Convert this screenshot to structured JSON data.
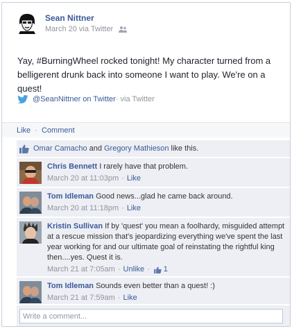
{
  "post": {
    "author": "Sean Nittner",
    "meta": "March 20 via Twitter",
    "text": "Yay, #BurningWheel rocked tonight! My character turned from a belligerent drunk back into someone I want to play. We're on a quest!",
    "source_handle": "@SeanNittner on Twitter",
    "source_suffix": " · via Twitter"
  },
  "actions": {
    "like": "Like",
    "separator": "·",
    "comment": "Comment"
  },
  "likes": {
    "person1": "Omar Camacho",
    "and": "and",
    "person2": "Gregory Mathieson",
    "suffix": "like this."
  },
  "comments": [
    {
      "name": "Chris Bennett",
      "text": "I rarely have that problem.",
      "time": "March 20 at 11:03pm",
      "like": "Like"
    },
    {
      "name": "Tom Idleman",
      "text": "Good news...glad he came back around.",
      "time": "March 20 at 11:18pm",
      "like": "Like"
    },
    {
      "name": "Kristin Sullivan",
      "text": "If by 'quest' you mean a foolhardy, misguided attempt at a rescue mission that's jeopardizing everything we've spent the last year working for and our ultimate goal of reinstating the rightful king then....yes. Quest it is.",
      "time": "March 21 at 7:05am",
      "like": "Unlike",
      "like_count": "1"
    },
    {
      "name": "Tom Idleman",
      "text": "Sounds even better than a quest! :)",
      "time": "March 21 at 7:59am",
      "like": "Like"
    }
  ],
  "write_comment": {
    "placeholder": "Write a comment..."
  },
  "colors": {
    "link": "#3b5998",
    "muted": "#90949c",
    "panel": "#edeff4"
  }
}
